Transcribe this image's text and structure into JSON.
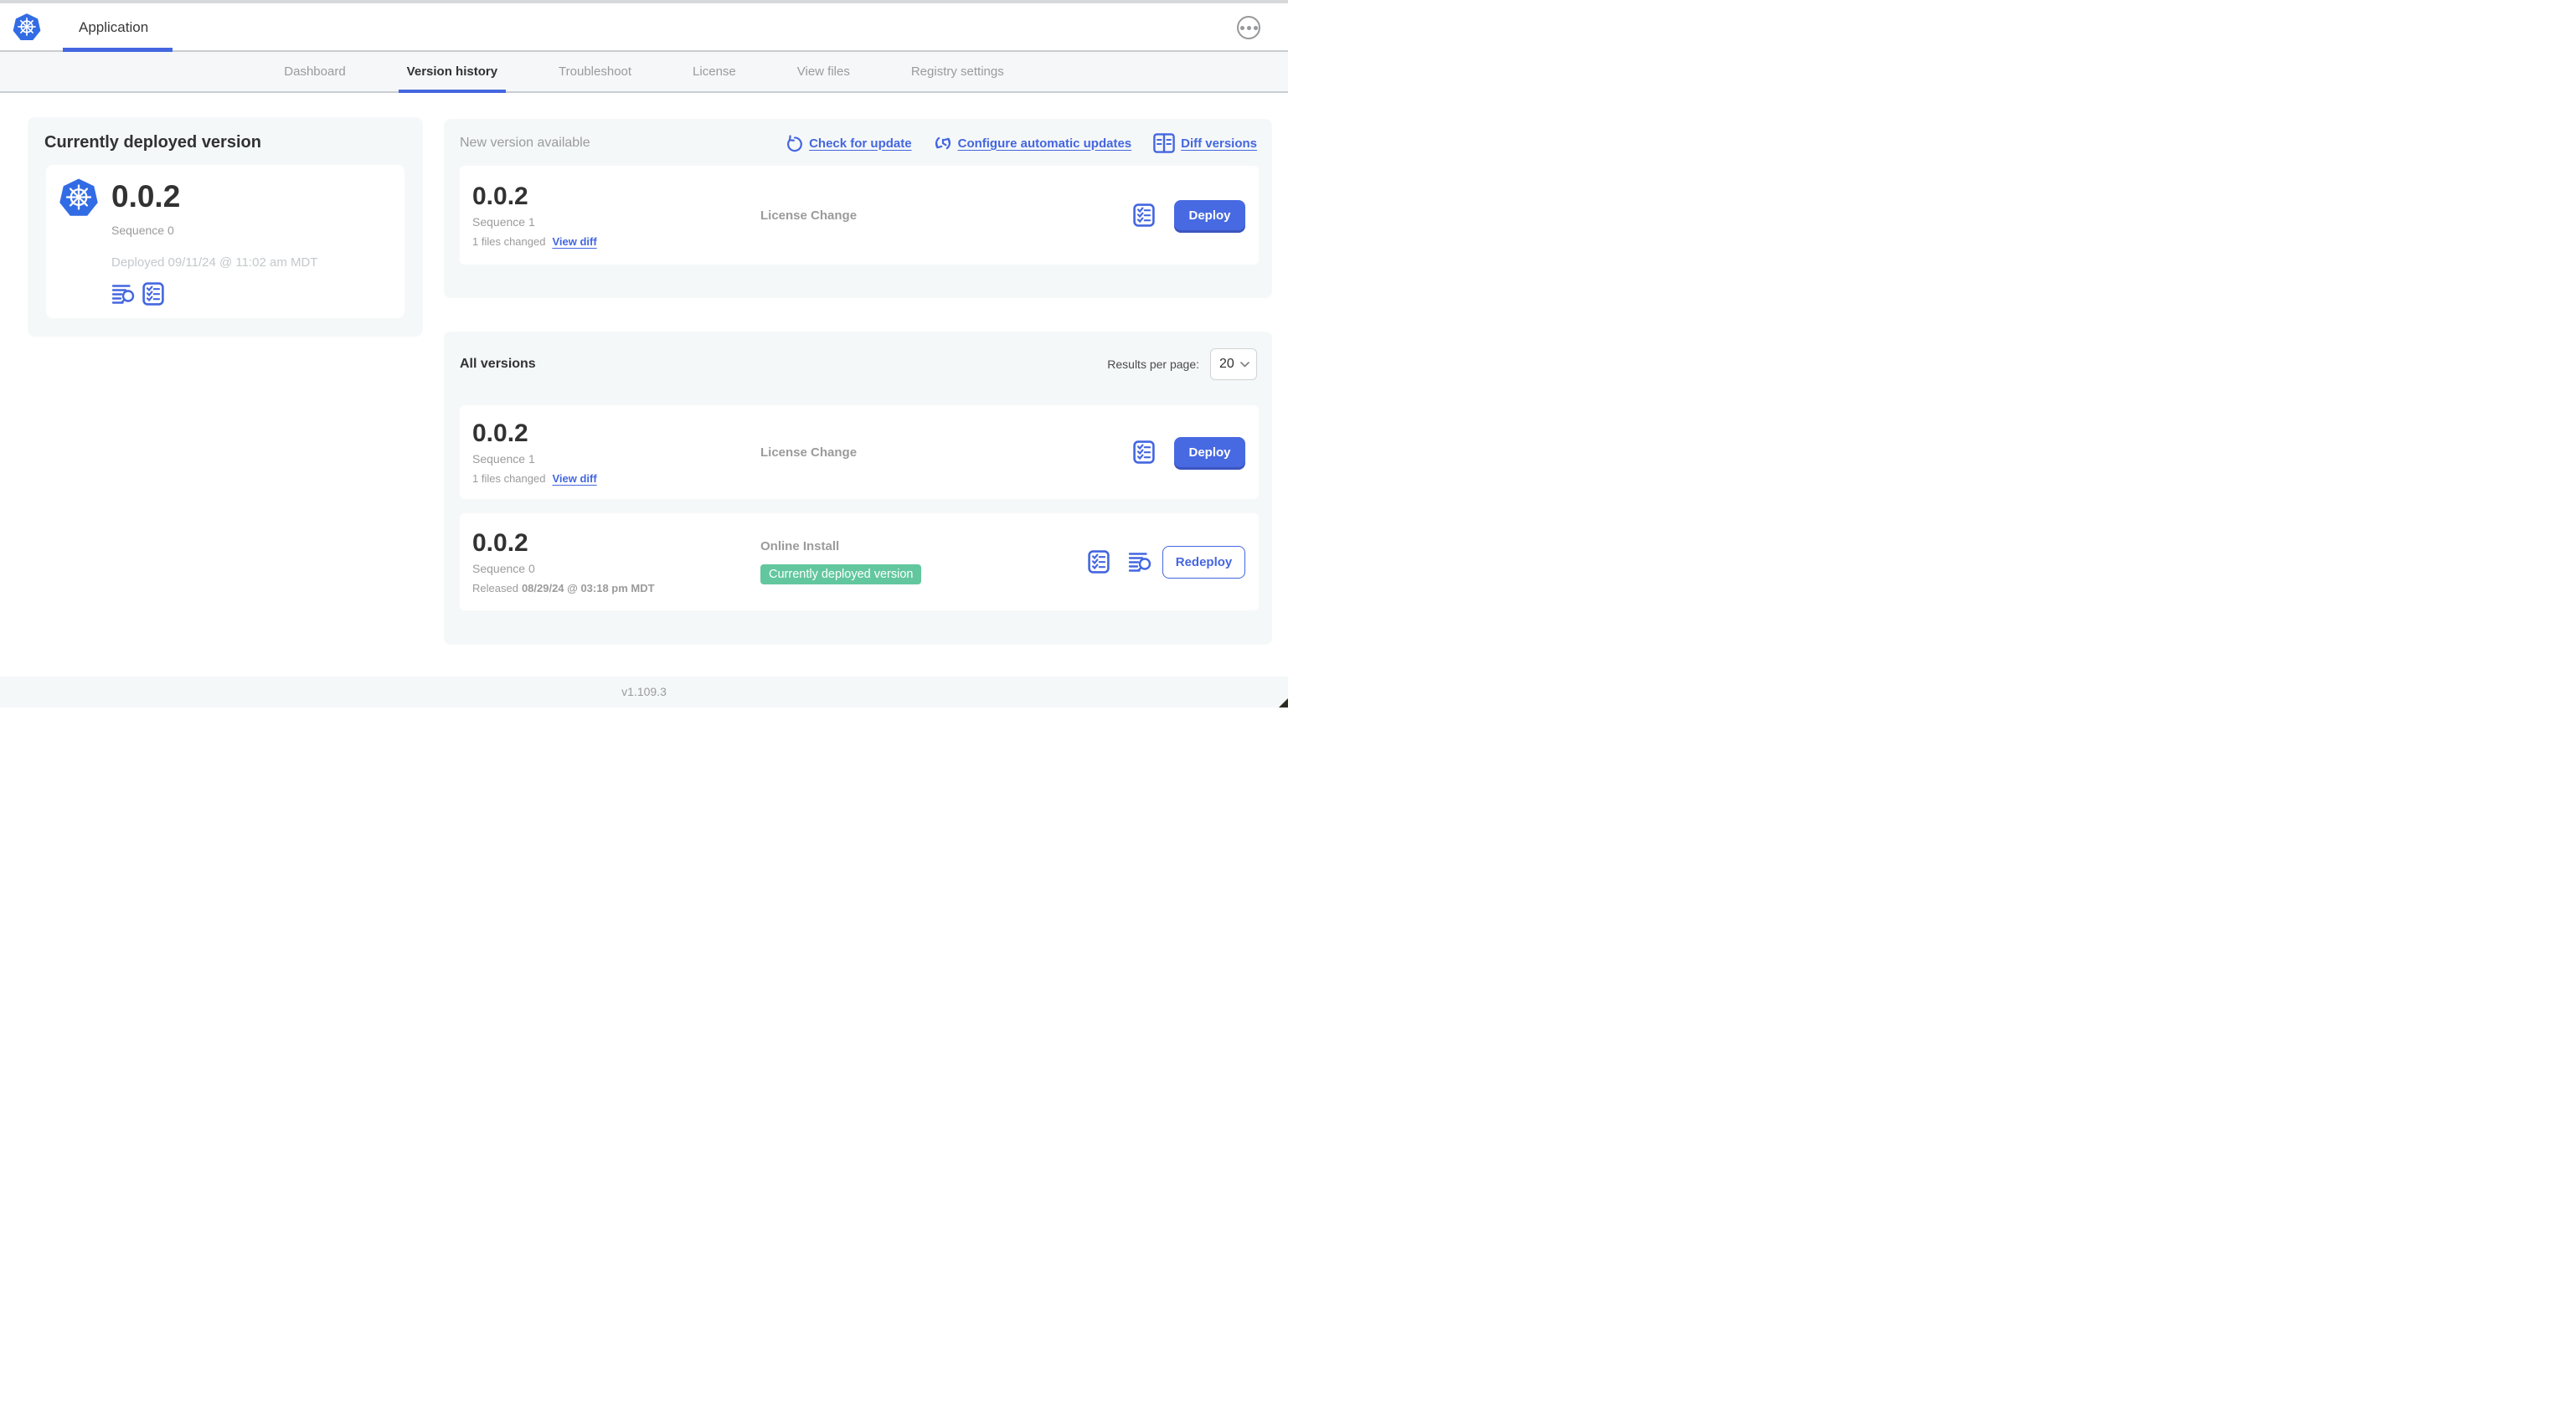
{
  "colors": {
    "accent_blue": "#4466e0",
    "kubernetes_blue": "#326ce5",
    "badge_green": "#62c79e",
    "section_background": "#f5f8f9"
  },
  "header": {
    "app_tab": "Application"
  },
  "nav_tabs": [
    {
      "label": "Dashboard",
      "active": false
    },
    {
      "label": "Version history",
      "active": true
    },
    {
      "label": "Troubleshoot",
      "active": false
    },
    {
      "label": "License",
      "active": false
    },
    {
      "label": "View files",
      "active": false
    },
    {
      "label": "Registry settings",
      "active": false
    }
  ],
  "currently_deployed": {
    "title": "Currently deployed version",
    "version": "0.0.2",
    "sequence": "Sequence 0",
    "deployed_timestamp": "Deployed 09/11/24 @ 11:02 am MDT"
  },
  "new_version": {
    "title": "New version available",
    "check_for_update": "Check for update",
    "configure_automatic_updates": "Configure automatic updates",
    "diff_versions": "Diff versions",
    "row": {
      "version": "0.0.2",
      "sequence": "Sequence 1",
      "files_changed": "1 files changed",
      "view_diff": "View diff",
      "source": "License Change",
      "action": "Deploy"
    }
  },
  "all_versions": {
    "title": "All versions",
    "results_per_page_label": "Results per page:",
    "results_per_page_value": "20",
    "rows": [
      {
        "version": "0.0.2",
        "sequence": "Sequence 1",
        "files_changed": "1 files changed",
        "view_diff": "View diff",
        "source": "License Change",
        "action": "Deploy"
      },
      {
        "version": "0.0.2",
        "sequence": "Sequence 0",
        "released_label": "Released",
        "released_date": "08/29/24 @ 03:18 pm MDT",
        "source": "Online Install",
        "badge": "Currently deployed version",
        "action": "Redeploy"
      }
    ]
  },
  "footer": {
    "app_manager_version": "v1.109.3"
  }
}
